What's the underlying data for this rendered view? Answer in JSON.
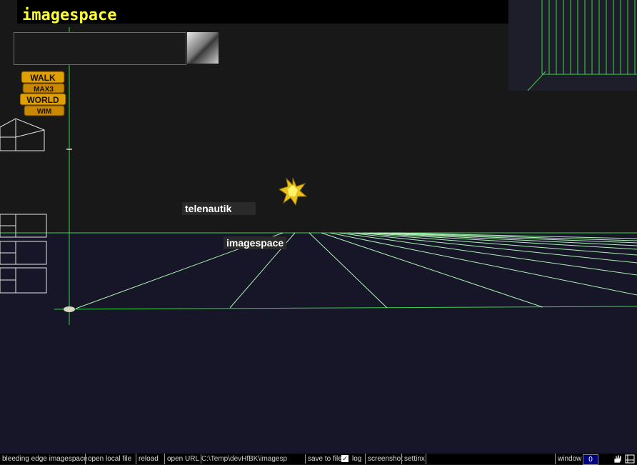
{
  "app": {
    "title": "imagespace"
  },
  "scene": {
    "labels": {
      "telenautik": "telenautik",
      "imagespace": "imagespace"
    }
  },
  "logo": {
    "lines": [
      "WALK",
      "MAX3",
      "WORLD",
      "WIM"
    ]
  },
  "toolbar": {
    "app_name": "bleeding edge imagespace",
    "open_local_file": "open local file",
    "reload": "reload",
    "open_url": "open URL",
    "path_value": "C:\\Temp\\devHfBK\\imagesp",
    "save_to_file": "save to file",
    "log_checked": "✓",
    "log": "log",
    "screenshot": "screenshot",
    "settinx": "settinx",
    "window": "window",
    "window_value": "0"
  },
  "colors": {
    "accent": "#ffff33",
    "grid": "#3cd24a",
    "floor": "#161628",
    "sky": "#181818"
  },
  "icons": [
    "gold-star-icon",
    "hand-icon",
    "resize-icon",
    "checkbox-icon"
  ]
}
